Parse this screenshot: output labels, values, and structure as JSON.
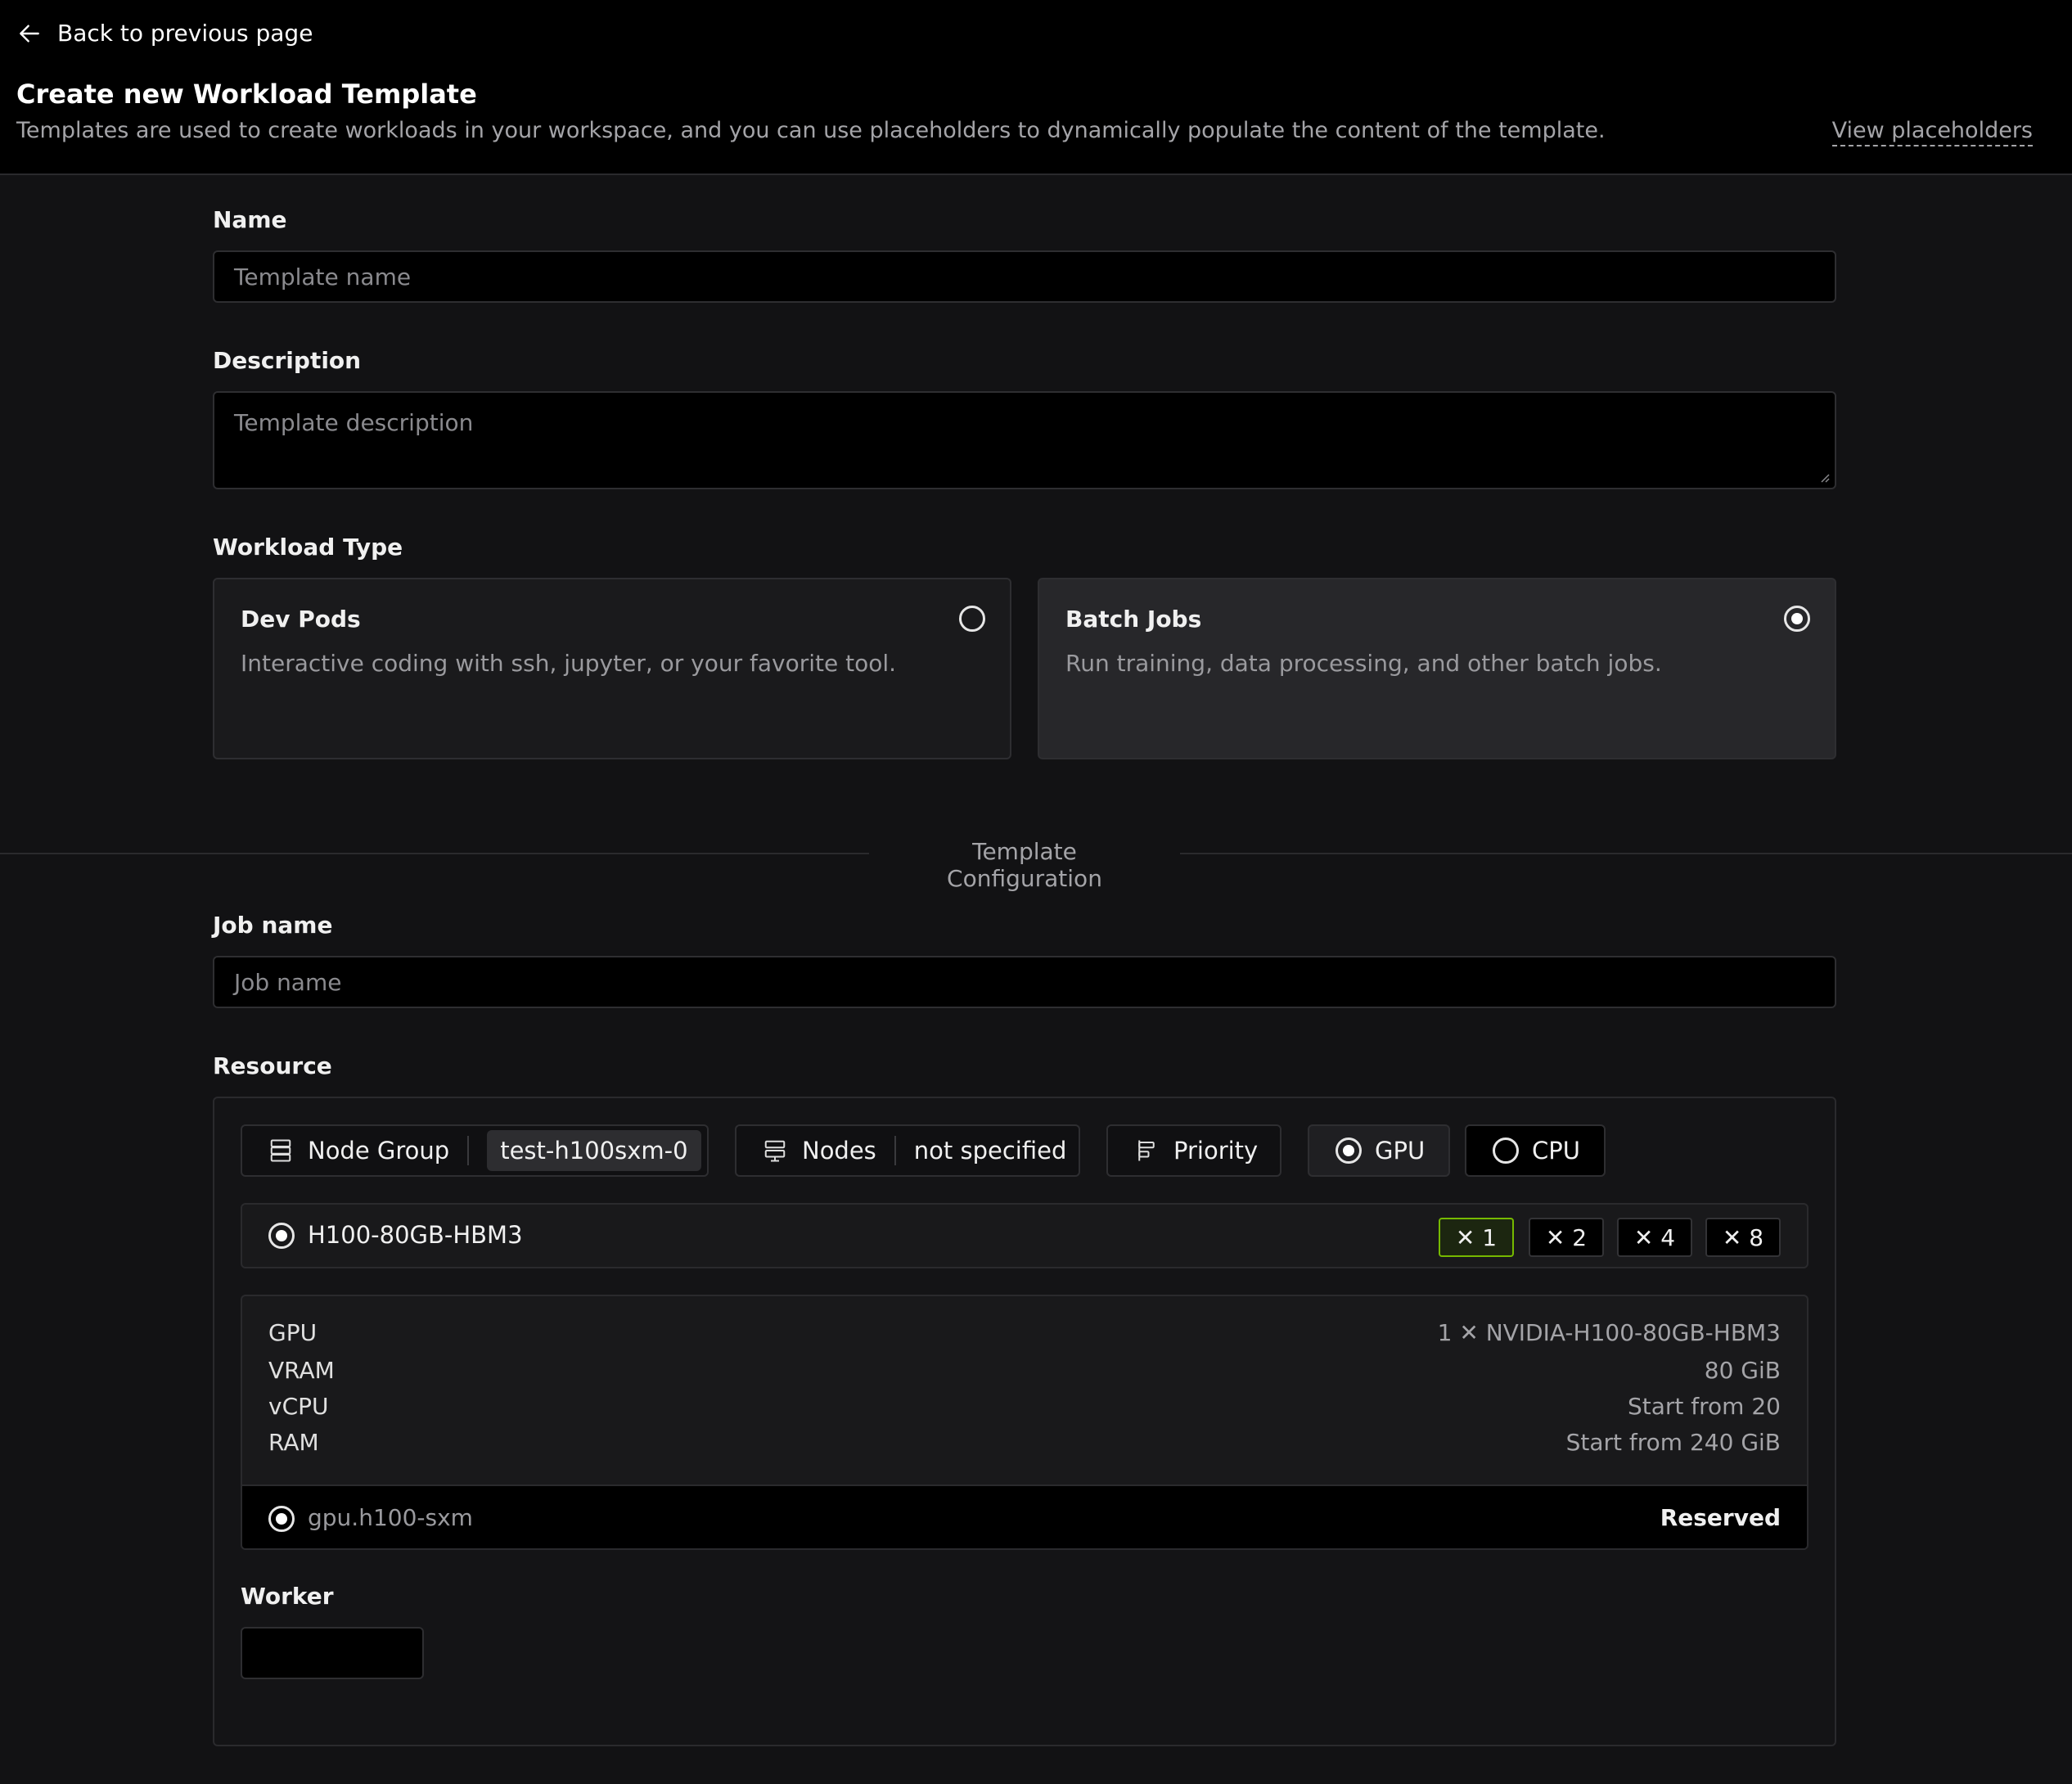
{
  "header": {
    "back_label": "Back to previous page",
    "title": "Create new Workload Template",
    "subtitle": "Templates are used to create workloads in your workspace, and you can use placeholders to dynamically populate the content of the template.",
    "view_placeholders": "View placeholders"
  },
  "form": {
    "name_label": "Name",
    "name_placeholder": "Template name",
    "description_label": "Description",
    "description_placeholder": "Template description",
    "workload_type_label": "Workload Type",
    "workload_types": [
      {
        "title": "Dev Pods",
        "description": "Interactive coding with ssh, jupyter, or your favorite tool.",
        "selected": false
      },
      {
        "title": "Batch Jobs",
        "description": "Run training, data processing, and other batch jobs.",
        "selected": true
      }
    ]
  },
  "config": {
    "section_title": "Template Configuration",
    "job_name_label": "Job name",
    "job_name_placeholder": "Job name",
    "resource_label": "Resource",
    "chips": {
      "node_group_label": "Node Group",
      "node_group_value": "test-h100sxm-0",
      "nodes_label": "Nodes",
      "nodes_value": "not specified",
      "priority_label": "Priority",
      "gpu_label": "GPU",
      "cpu_label": "CPU",
      "selected": "GPU"
    },
    "gpu_option": {
      "name": "H100-80GB-HBM3",
      "multipliers": [
        "1",
        "2",
        "4",
        "8"
      ],
      "selected_multiplier": "1"
    },
    "specs": [
      {
        "key": "GPU",
        "value": "1 ✕ NVIDIA-H100-80GB-HBM3"
      },
      {
        "key": "VRAM",
        "value": "80 GiB"
      },
      {
        "key": "vCPU",
        "value": "Start from 20"
      },
      {
        "key": "RAM",
        "value": "Start from 240 GiB"
      }
    ],
    "offer": {
      "name": "gpu.h100-sxm",
      "status": "Reserved"
    },
    "worker_label": "Worker",
    "worker_value": ""
  },
  "colors": {
    "background": "#121214",
    "header_bg": "#000000",
    "accent_green": "#76b900"
  },
  "icons": [
    "arrow-left-icon",
    "server-icon",
    "nodes-icon",
    "priority-icon",
    "radio-icon",
    "close-icon"
  ]
}
